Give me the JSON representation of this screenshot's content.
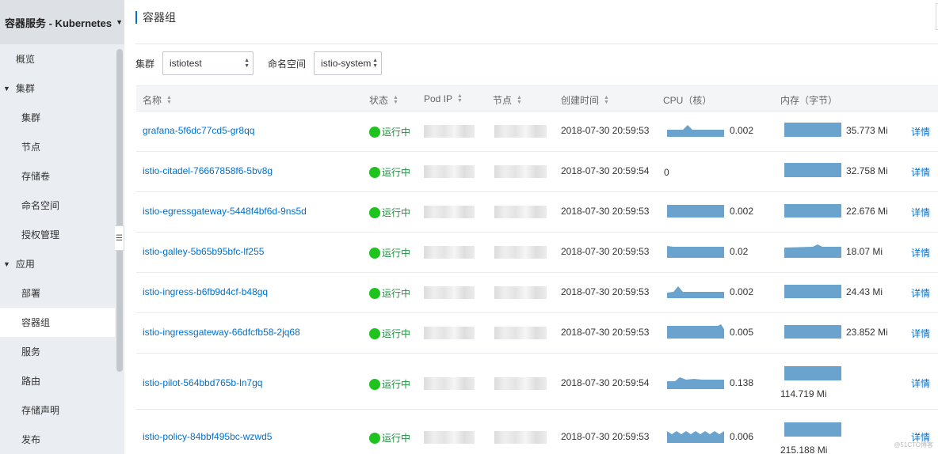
{
  "sidebar": {
    "title": "容器服务 - Kubernetes",
    "items": [
      {
        "label": "概览",
        "kind": "top"
      },
      {
        "label": "集群",
        "kind": "group"
      },
      {
        "label": "集群",
        "kind": "sub"
      },
      {
        "label": "节点",
        "kind": "sub"
      },
      {
        "label": "存储卷",
        "kind": "sub"
      },
      {
        "label": "命名空间",
        "kind": "sub"
      },
      {
        "label": "授权管理",
        "kind": "sub"
      },
      {
        "label": "应用",
        "kind": "group"
      },
      {
        "label": "部署",
        "kind": "sub"
      },
      {
        "label": "容器组",
        "kind": "sub",
        "active": true
      },
      {
        "label": "服务",
        "kind": "sub"
      },
      {
        "label": "路由",
        "kind": "sub"
      },
      {
        "label": "存储声明",
        "kind": "sub"
      },
      {
        "label": "发布",
        "kind": "sub"
      }
    ]
  },
  "page": {
    "title": "容器组"
  },
  "filters": {
    "cluster_label": "集群",
    "cluster_value": "istiotest",
    "namespace_label": "命名空间",
    "namespace_value": "istio-system"
  },
  "table": {
    "headers": {
      "name": "名称",
      "status": "状态",
      "pod_ip": "Pod IP",
      "node": "节点",
      "created": "创建时间",
      "cpu": "CPU（核）",
      "memory": "内存（字节）"
    },
    "rows": [
      {
        "name": "grafana-5f6dc77cd5-gr8qq",
        "status": "运行中",
        "created": "2018-07-30 20:59:53",
        "cpu": "0.002",
        "memory": "35.773 Mi",
        "detail": "详情"
      },
      {
        "name": "istio-citadel-76667858f6-5bv8g",
        "status": "运行中",
        "created": "2018-07-30 20:59:54",
        "cpu": "0",
        "memory": "32.758 Mi",
        "detail": "详情"
      },
      {
        "name": "istio-egressgateway-5448f4bf6d-9ns5d",
        "status": "运行中",
        "created": "2018-07-30 20:59:53",
        "cpu": "0.002",
        "memory": "22.676 Mi",
        "detail": "详情"
      },
      {
        "name": "istio-galley-5b65b95bfc-lf255",
        "status": "运行中",
        "created": "2018-07-30 20:59:53",
        "cpu": "0.02",
        "memory": "18.07 Mi",
        "detail": "详情"
      },
      {
        "name": "istio-ingress-b6fb9d4cf-b48gq",
        "status": "运行中",
        "created": "2018-07-30 20:59:53",
        "cpu": "0.002",
        "memory": "24.43 Mi",
        "detail": "详情"
      },
      {
        "name": "istio-ingressgateway-66dfcfb58-2jq68",
        "status": "运行中",
        "created": "2018-07-30 20:59:53",
        "cpu": "0.005",
        "memory": "23.852 Mi",
        "detail": "详情"
      },
      {
        "name": "istio-pilot-564bbd765b-ln7gq",
        "status": "运行中",
        "created": "2018-07-30 20:59:54",
        "cpu": "0.138",
        "memory": "114.719 Mi",
        "detail": "详情"
      },
      {
        "name": "istio-policy-84bbf495bc-wzwd5",
        "status": "运行中",
        "created": "2018-07-30 20:59:53",
        "cpu": "0.006",
        "memory": "215.188 Mi",
        "detail": "详情"
      }
    ]
  },
  "watermark": "@51CTO博客",
  "colors": {
    "accent": "#0070cc",
    "running": "#1ec31e",
    "spark": "#6ba3cf"
  },
  "icons": {
    "sort": "sort-icon",
    "status": "status-dot-icon",
    "caret": "caret-down-icon",
    "collapse": "sidebar-collapse-icon"
  }
}
